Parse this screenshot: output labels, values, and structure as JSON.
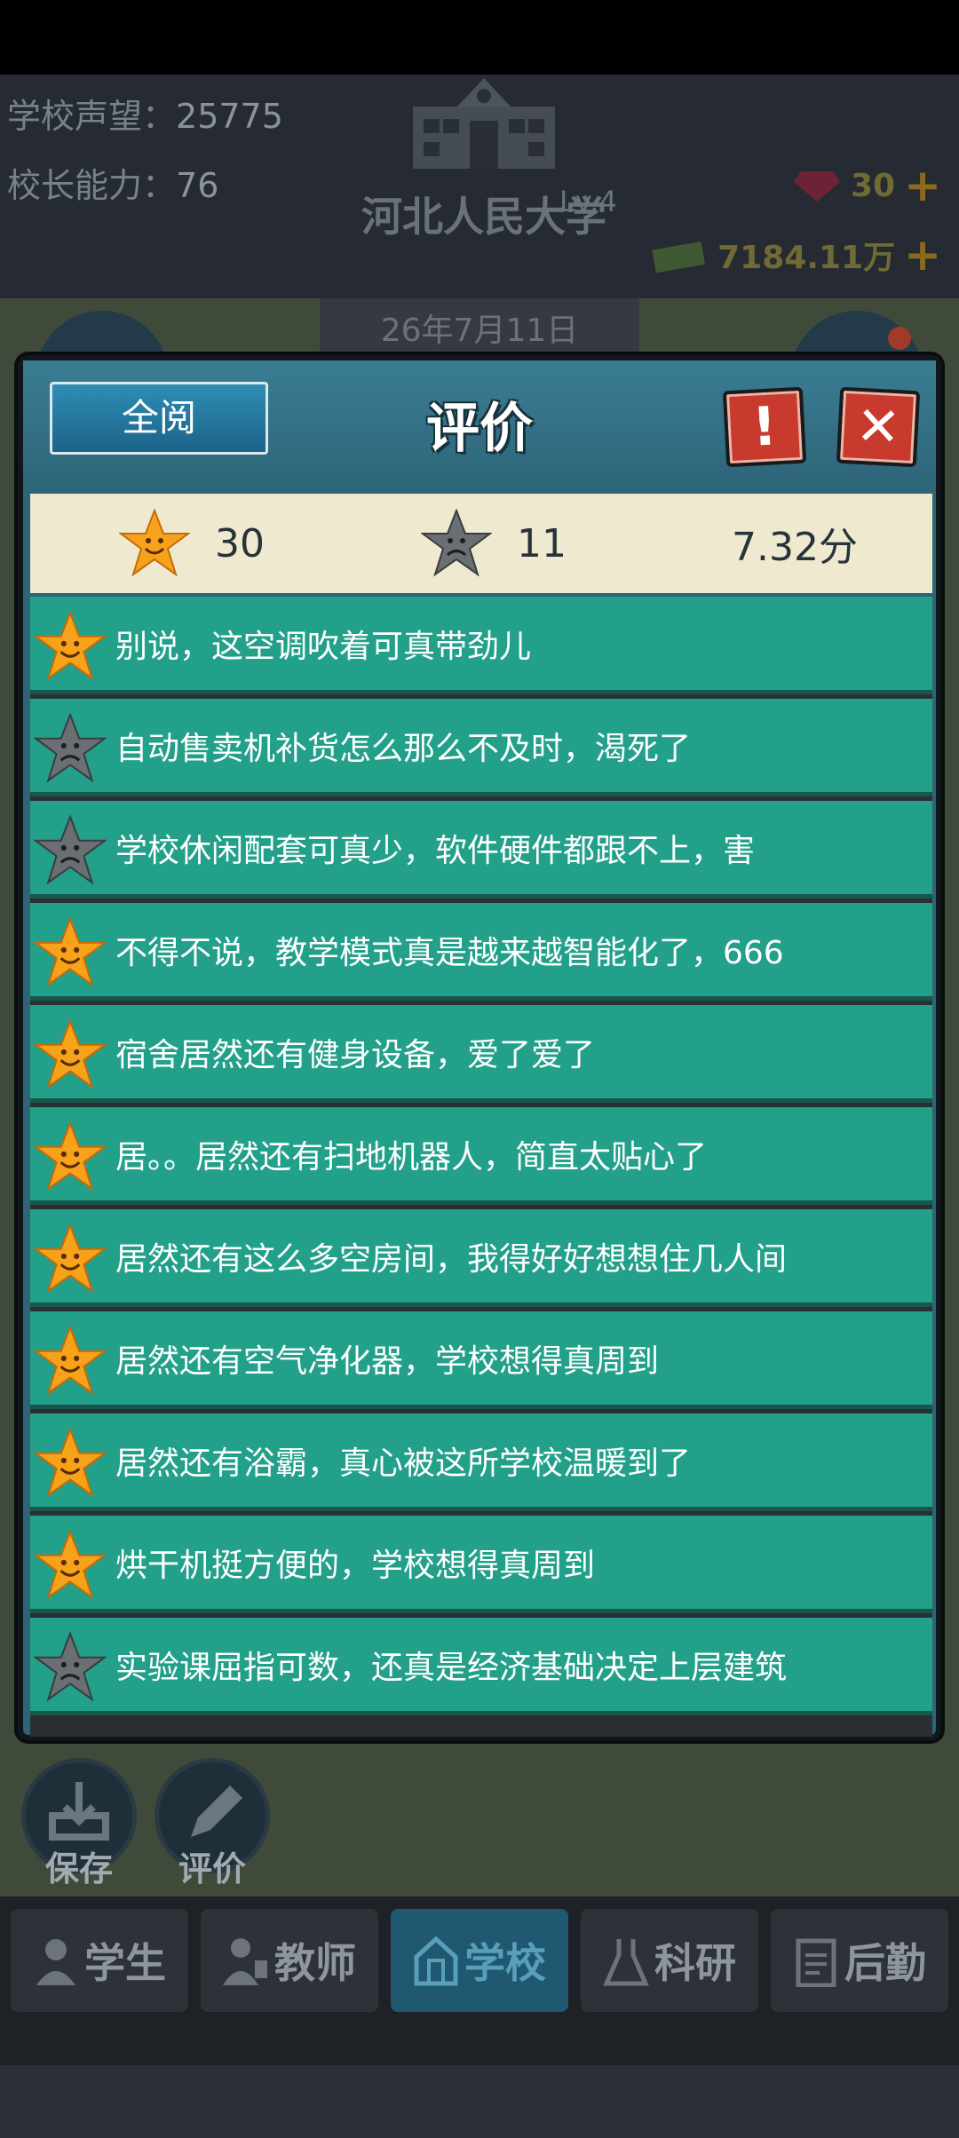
{
  "hud": {
    "reputation_label": "学校声望：",
    "reputation_value": "25775",
    "ability_label": "校长能力：",
    "ability_value": "76",
    "level": "Lv.4",
    "school_name": "河北人民大学",
    "gems": "30",
    "money": "7184.11万",
    "date": "26年7月11日"
  },
  "dialog": {
    "read_all_label": "全阅",
    "title": "评价",
    "info_label": "!",
    "close_label": "✕",
    "summary": {
      "good_count": "30",
      "bad_count": "11",
      "score": "7.32分"
    },
    "reviews": [
      {
        "sentiment": "good",
        "text": "别说，这空调吹着可真带劲儿"
      },
      {
        "sentiment": "bad",
        "text": "自动售卖机补货怎么那么不及时，渴死了"
      },
      {
        "sentiment": "bad",
        "text": "学校休闲配套可真少，软件硬件都跟不上，害"
      },
      {
        "sentiment": "good",
        "text": "不得不说，教学模式真是越来越智能化了，666"
      },
      {
        "sentiment": "good",
        "text": "宿舍居然还有健身设备，爱了爱了"
      },
      {
        "sentiment": "good",
        "text": "居。。居然还有扫地机器人，简直太贴心了"
      },
      {
        "sentiment": "good",
        "text": "居然还有这么多空房间，我得好好想想住几人间"
      },
      {
        "sentiment": "good",
        "text": "居然还有空气净化器，学校想得真周到"
      },
      {
        "sentiment": "good",
        "text": "居然还有浴霸，真心被这所学校温暖到了"
      },
      {
        "sentiment": "good",
        "text": "烘干机挺方便的，学校想得真周到"
      },
      {
        "sentiment": "bad",
        "text": "实验课屈指可数，还真是经济基础决定上层建筑"
      }
    ]
  },
  "bottom": {
    "save_label": "保存",
    "review_label": "评价",
    "tabs": [
      {
        "label": "学生",
        "icon": "student-icon"
      },
      {
        "label": "教师",
        "icon": "teacher-icon"
      },
      {
        "label": "学校",
        "icon": "school-icon"
      },
      {
        "label": "科研",
        "icon": "flask-icon"
      },
      {
        "label": "后勤",
        "icon": "clipboard-icon"
      }
    ]
  },
  "colors": {
    "row_bg": "#22a08a",
    "good_star": "#f7a21b",
    "bad_star": "#5a5f63",
    "accent": "#c73a2d"
  }
}
